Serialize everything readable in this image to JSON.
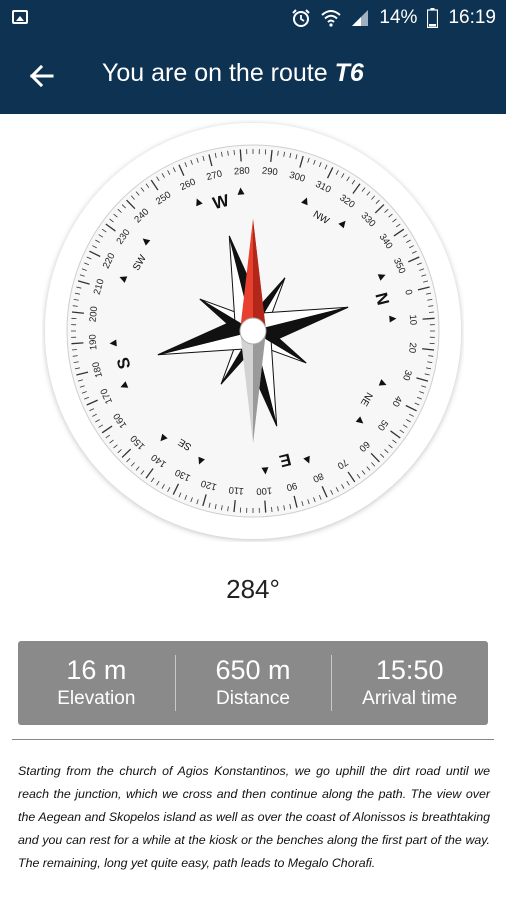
{
  "status_bar": {
    "battery": "14%",
    "time": "16:19",
    "icons": [
      "gallery-icon",
      "alarm-icon",
      "wifi-icon",
      "signal-icon",
      "battery-icon"
    ]
  },
  "app_bar": {
    "title_prefix": "You are on the route ",
    "route": "T6",
    "back_icon": "arrow-left-icon"
  },
  "compass": {
    "heading_deg": 284,
    "heading_label": "284°",
    "cardinals": [
      "N",
      "E",
      "S",
      "W"
    ],
    "intercardinals": [
      "NE",
      "SE",
      "SW",
      "NW"
    ],
    "ring_labels": [
      "0",
      "10",
      "20",
      "30",
      "40",
      "50",
      "60",
      "70",
      "80",
      "90",
      "100",
      "110",
      "120",
      "130",
      "140",
      "150",
      "160",
      "170",
      "180",
      "190",
      "200",
      "210",
      "220",
      "230",
      "240",
      "250",
      "260",
      "270",
      "280",
      "290",
      "300",
      "310",
      "320",
      "330",
      "340",
      "350"
    ]
  },
  "stats": [
    {
      "value": "16 m",
      "label": "Elevation"
    },
    {
      "value": "650 m",
      "label": "Distance"
    },
    {
      "value": "15:50",
      "label": "Arrival time"
    }
  ],
  "description": "Starting from the church of Agios Konstantinos, we go uphill the dirt road until we reach the junction, which we cross and then continue along the path. The view over the Aegean and Skopelos island as well as over the coast of Alonissos is breathtaking and you can rest for a while at the kiosk or the benches along the first part of the way. The remaining, long yet quite easy, path leads to Megalo Chorafi.",
  "colors": {
    "header": "#0e3352",
    "stats_bg": "#8a8a8a",
    "needle_north": "#e8402e",
    "needle_south": "#cccccc"
  }
}
